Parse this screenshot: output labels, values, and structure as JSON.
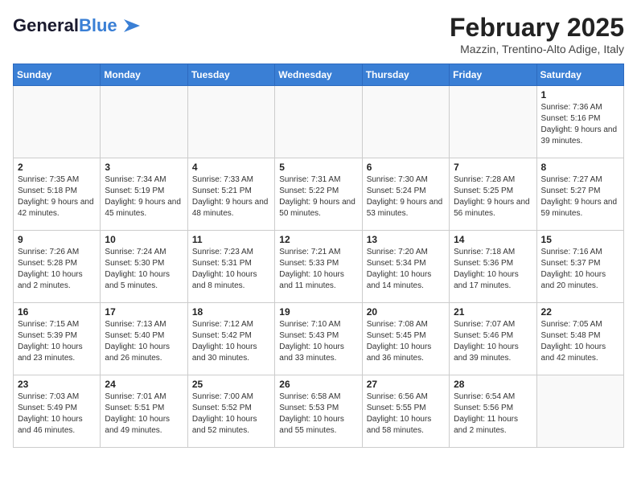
{
  "header": {
    "logo_general": "General",
    "logo_blue": "Blue",
    "month_year": "February 2025",
    "location": "Mazzin, Trentino-Alto Adige, Italy"
  },
  "weekdays": [
    "Sunday",
    "Monday",
    "Tuesday",
    "Wednesday",
    "Thursday",
    "Friday",
    "Saturday"
  ],
  "weeks": [
    [
      {
        "day": "",
        "info": ""
      },
      {
        "day": "",
        "info": ""
      },
      {
        "day": "",
        "info": ""
      },
      {
        "day": "",
        "info": ""
      },
      {
        "day": "",
        "info": ""
      },
      {
        "day": "",
        "info": ""
      },
      {
        "day": "1",
        "info": "Sunrise: 7:36 AM\nSunset: 5:16 PM\nDaylight: 9 hours and 39 minutes."
      }
    ],
    [
      {
        "day": "2",
        "info": "Sunrise: 7:35 AM\nSunset: 5:18 PM\nDaylight: 9 hours and 42 minutes."
      },
      {
        "day": "3",
        "info": "Sunrise: 7:34 AM\nSunset: 5:19 PM\nDaylight: 9 hours and 45 minutes."
      },
      {
        "day": "4",
        "info": "Sunrise: 7:33 AM\nSunset: 5:21 PM\nDaylight: 9 hours and 48 minutes."
      },
      {
        "day": "5",
        "info": "Sunrise: 7:31 AM\nSunset: 5:22 PM\nDaylight: 9 hours and 50 minutes."
      },
      {
        "day": "6",
        "info": "Sunrise: 7:30 AM\nSunset: 5:24 PM\nDaylight: 9 hours and 53 minutes."
      },
      {
        "day": "7",
        "info": "Sunrise: 7:28 AM\nSunset: 5:25 PM\nDaylight: 9 hours and 56 minutes."
      },
      {
        "day": "8",
        "info": "Sunrise: 7:27 AM\nSunset: 5:27 PM\nDaylight: 9 hours and 59 minutes."
      }
    ],
    [
      {
        "day": "9",
        "info": "Sunrise: 7:26 AM\nSunset: 5:28 PM\nDaylight: 10 hours and 2 minutes."
      },
      {
        "day": "10",
        "info": "Sunrise: 7:24 AM\nSunset: 5:30 PM\nDaylight: 10 hours and 5 minutes."
      },
      {
        "day": "11",
        "info": "Sunrise: 7:23 AM\nSunset: 5:31 PM\nDaylight: 10 hours and 8 minutes."
      },
      {
        "day": "12",
        "info": "Sunrise: 7:21 AM\nSunset: 5:33 PM\nDaylight: 10 hours and 11 minutes."
      },
      {
        "day": "13",
        "info": "Sunrise: 7:20 AM\nSunset: 5:34 PM\nDaylight: 10 hours and 14 minutes."
      },
      {
        "day": "14",
        "info": "Sunrise: 7:18 AM\nSunset: 5:36 PM\nDaylight: 10 hours and 17 minutes."
      },
      {
        "day": "15",
        "info": "Sunrise: 7:16 AM\nSunset: 5:37 PM\nDaylight: 10 hours and 20 minutes."
      }
    ],
    [
      {
        "day": "16",
        "info": "Sunrise: 7:15 AM\nSunset: 5:39 PM\nDaylight: 10 hours and 23 minutes."
      },
      {
        "day": "17",
        "info": "Sunrise: 7:13 AM\nSunset: 5:40 PM\nDaylight: 10 hours and 26 minutes."
      },
      {
        "day": "18",
        "info": "Sunrise: 7:12 AM\nSunset: 5:42 PM\nDaylight: 10 hours and 30 minutes."
      },
      {
        "day": "19",
        "info": "Sunrise: 7:10 AM\nSunset: 5:43 PM\nDaylight: 10 hours and 33 minutes."
      },
      {
        "day": "20",
        "info": "Sunrise: 7:08 AM\nSunset: 5:45 PM\nDaylight: 10 hours and 36 minutes."
      },
      {
        "day": "21",
        "info": "Sunrise: 7:07 AM\nSunset: 5:46 PM\nDaylight: 10 hours and 39 minutes."
      },
      {
        "day": "22",
        "info": "Sunrise: 7:05 AM\nSunset: 5:48 PM\nDaylight: 10 hours and 42 minutes."
      }
    ],
    [
      {
        "day": "23",
        "info": "Sunrise: 7:03 AM\nSunset: 5:49 PM\nDaylight: 10 hours and 46 minutes."
      },
      {
        "day": "24",
        "info": "Sunrise: 7:01 AM\nSunset: 5:51 PM\nDaylight: 10 hours and 49 minutes."
      },
      {
        "day": "25",
        "info": "Sunrise: 7:00 AM\nSunset: 5:52 PM\nDaylight: 10 hours and 52 minutes."
      },
      {
        "day": "26",
        "info": "Sunrise: 6:58 AM\nSunset: 5:53 PM\nDaylight: 10 hours and 55 minutes."
      },
      {
        "day": "27",
        "info": "Sunrise: 6:56 AM\nSunset: 5:55 PM\nDaylight: 10 hours and 58 minutes."
      },
      {
        "day": "28",
        "info": "Sunrise: 6:54 AM\nSunset: 5:56 PM\nDaylight: 11 hours and 2 minutes."
      },
      {
        "day": "",
        "info": ""
      }
    ]
  ]
}
